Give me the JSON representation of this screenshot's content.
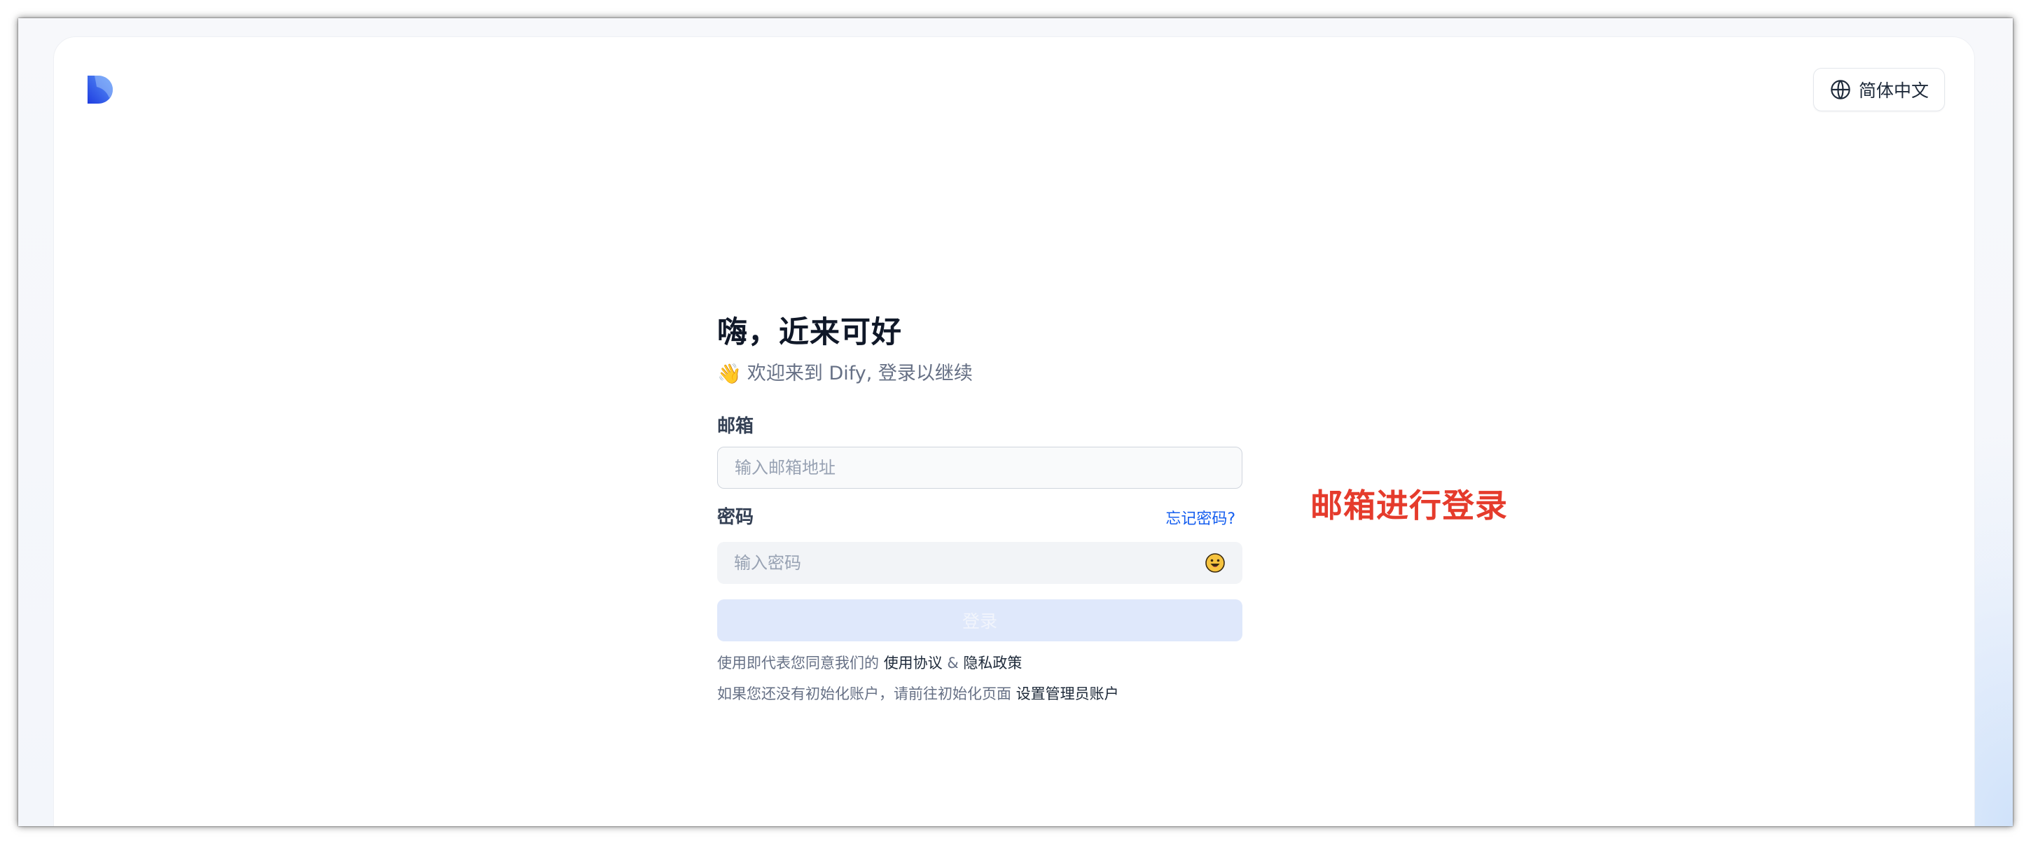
{
  "header": {
    "language_label": "简体中文"
  },
  "login": {
    "title": "嗨，近来可好",
    "subtitle": "欢迎来到 Dify, 登录以继续",
    "email_label": "邮箱",
    "email_placeholder": "输入邮箱地址",
    "email_value": "",
    "password_label": "密码",
    "forgot_password": "忘记密码?",
    "password_placeholder": "输入密码",
    "password_value": "",
    "login_button": "登录",
    "terms_prefix": "使用即代表您同意我们的 ",
    "terms_link": "使用协议",
    "terms_and": " & ",
    "privacy_link": "隐私政策",
    "setup_prefix": "如果您还没有初始化账户，请前往初始化页面 ",
    "setup_link": "设置管理员账户"
  },
  "annotation": {
    "text": "邮箱进行登录",
    "color": "#e53b2c"
  },
  "colors": {
    "link_blue": "#155eef",
    "button_disabled_bg": "#dfe8fb",
    "logo_gradient_start": "#1f3de0",
    "logo_gradient_end": "#4f8cf7"
  },
  "icons": {
    "logo": "dify-logo-icon",
    "language": "globe-icon",
    "subtitle": "waving-hand-icon",
    "password_toggle": "eye-toggle-emoji-icon"
  }
}
